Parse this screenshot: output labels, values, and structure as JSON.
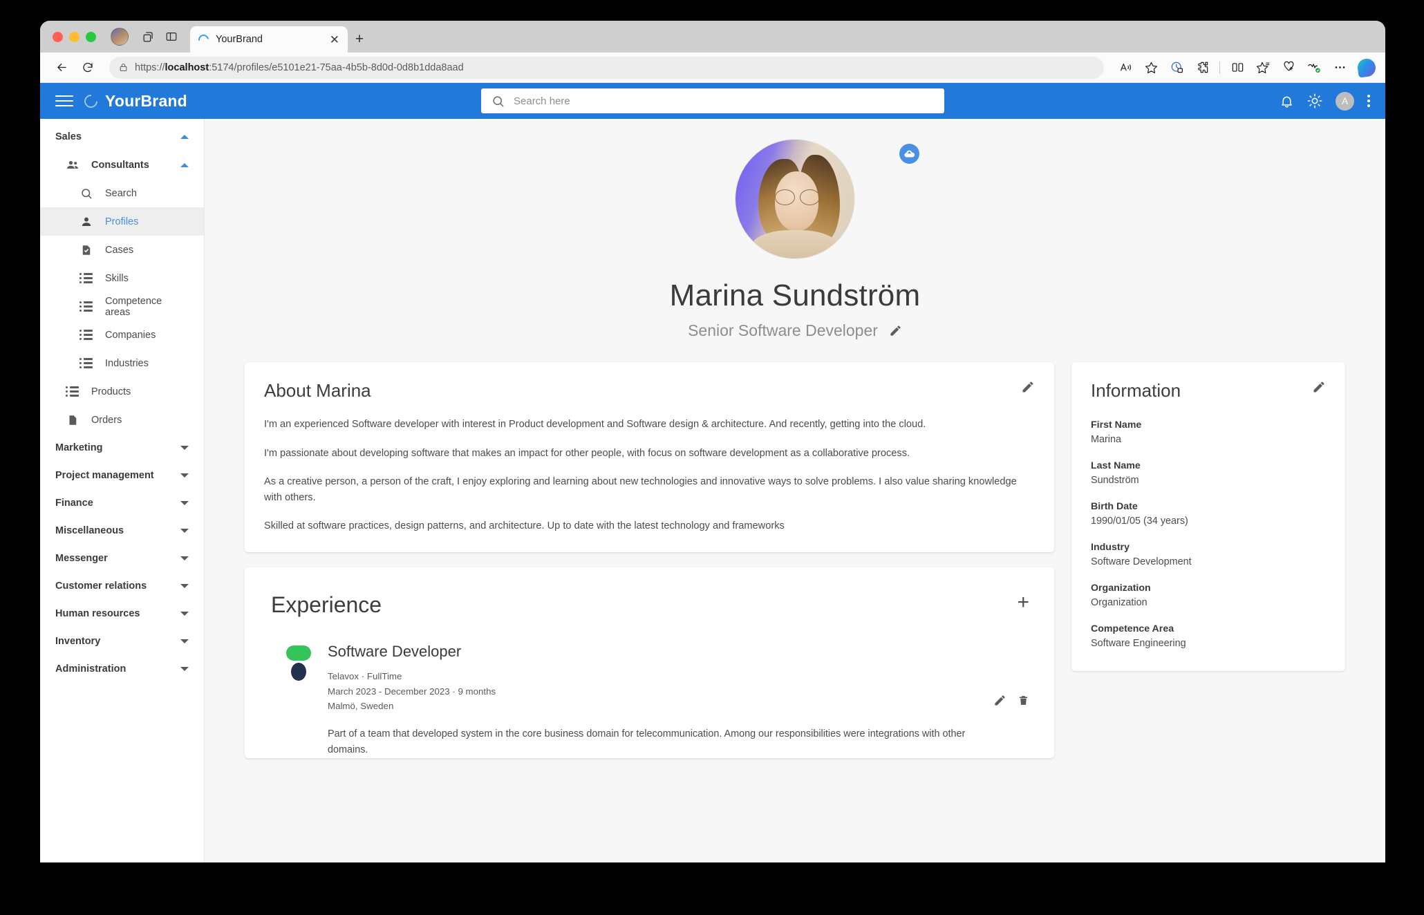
{
  "browser": {
    "tab": {
      "title": "YourBrand",
      "spinner_icon": "loading-spinner-icon",
      "close_icon": "close-icon"
    },
    "newtab_label": "+",
    "url": {
      "scheme": "https://",
      "host": "localhost",
      "rest": ":5174/profiles/e5101e21-75aa-4b5b-8d0d-0d8b1dda8aad"
    },
    "toolbar_icons": [
      "read-aloud-icon",
      "favorite-star-icon",
      "tracking-prevention-icon",
      "extensions-icon",
      "split-screen-icon",
      "collections-icon",
      "add-favorite-icon",
      "browser-essentials-icon",
      "settings-more-icon",
      "copilot-icon"
    ],
    "nav_icons": [
      "back-icon",
      "refresh-icon",
      "site-lock-icon"
    ],
    "chrome_icons": [
      "profile-avatar-icon",
      "tab-groups-icon",
      "split-pane-icon"
    ]
  },
  "appbar": {
    "menu_icon": "hamburger-menu-icon",
    "brand_mark_icon": "brand-ring-icon",
    "brand": "YourBrand",
    "search": {
      "placeholder": "Search here",
      "value": "",
      "icon": "search-icon"
    },
    "notifications_icon": "bell-icon",
    "theme_icon": "sun-icon",
    "avatar_initial": "A",
    "more_icon": "kebab-menu-icon",
    "accent_color": "#2179d9"
  },
  "sidebar": {
    "groups": [
      {
        "label": "Sales",
        "expanded": true,
        "sub": [
          {
            "label": "Consultants",
            "icon": "people-icon",
            "expanded": true,
            "items": [
              {
                "label": "Search",
                "icon": "search-icon",
                "active": false
              },
              {
                "label": "Profiles",
                "icon": "person-icon",
                "active": true
              },
              {
                "label": "Cases",
                "icon": "document-check-icon",
                "active": false
              },
              {
                "label": "Skills",
                "icon": "list-icon",
                "active": false
              },
              {
                "label": "Competence areas",
                "icon": "list-icon",
                "active": false
              },
              {
                "label": "Companies",
                "icon": "list-icon",
                "active": false
              },
              {
                "label": "Industries",
                "icon": "list-icon",
                "active": false
              }
            ]
          }
        ],
        "items": [
          {
            "label": "Products",
            "icon": "list-icon"
          },
          {
            "label": "Orders",
            "icon": "document-icon"
          }
        ]
      },
      {
        "label": "Marketing",
        "expanded": false
      },
      {
        "label": "Project management",
        "expanded": false
      },
      {
        "label": "Finance",
        "expanded": false
      },
      {
        "label": "Miscellaneous",
        "expanded": false
      },
      {
        "label": "Messenger",
        "expanded": false
      },
      {
        "label": "Customer relations",
        "expanded": false
      },
      {
        "label": "Human resources",
        "expanded": false
      },
      {
        "label": "Inventory",
        "expanded": false
      },
      {
        "label": "Administration",
        "expanded": false
      }
    ]
  },
  "profile": {
    "avatar_alt": "profile-photo",
    "upload_icon": "cloud-upload-icon",
    "name": "Marina Sundström",
    "title": "Senior Software Developer",
    "edit_title_icon": "pencil-icon"
  },
  "about": {
    "title": "About Marina",
    "edit_icon": "pencil-icon",
    "paragraphs": [
      "I'm an experienced Software developer with interest in Product development and Software design & architecture. And recently, getting into the cloud.",
      "I'm passionate about developing software that makes an impact for other people, with focus on software development as a collaborative process.",
      "As a creative person, a person of the craft, I enjoy exploring and learning about new technologies and innovative ways to solve problems. I also value sharing knowledge with others.",
      "Skilled at software practices, design patterns, and architecture. Up to date with the latest technology and frameworks"
    ]
  },
  "information": {
    "title": "Information",
    "edit_icon": "pencil-icon",
    "fields": [
      {
        "label": "First Name",
        "value": "Marina"
      },
      {
        "label": "Last Name",
        "value": "Sundström"
      },
      {
        "label": "Birth Date",
        "value": "1990/01/05 (34 years)"
      },
      {
        "label": "Industry",
        "value": "Software Development"
      },
      {
        "label": "Organization",
        "value": "Organization"
      },
      {
        "label": "Competence Area",
        "value": "Software Engineering"
      }
    ]
  },
  "experience": {
    "title": "Experience",
    "add_label": "+",
    "entries": [
      {
        "logo": "telavox-logo-icon",
        "role": "Software Developer",
        "company_line": "Telavox · FullTime",
        "dates": "March 2023 - December 2023 · 9 months",
        "location": "Malmö, Sweden",
        "description": "Part of a team that developed system in the core business domain for telecommunication. Among our responsibilities were integrations with other domains.",
        "edit_icon": "pencil-icon",
        "delete_icon": "trash-icon"
      }
    ]
  }
}
